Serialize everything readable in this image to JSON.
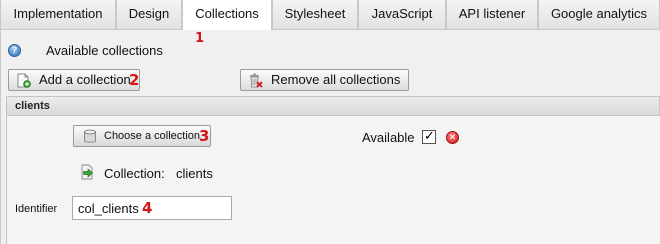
{
  "tabs": [
    {
      "label": "Implementation",
      "active": false
    },
    {
      "label": "Design",
      "active": false
    },
    {
      "label": "Collections",
      "active": true
    },
    {
      "label": "Stylesheet",
      "active": false
    },
    {
      "label": "JavaScript",
      "active": false
    },
    {
      "label": "API listener",
      "active": false
    },
    {
      "label": "Google analytics",
      "active": false
    }
  ],
  "annotations": {
    "n1": "1",
    "n2": "2",
    "n3": "3",
    "n4": "4"
  },
  "section": {
    "title": "Available collections",
    "help_icon": "help-icon"
  },
  "toolbar": {
    "add_label": "Add a collection",
    "add_icon": "add-document-icon",
    "remove_all_label": "Remove all collections",
    "remove_all_icon": "trash-delete-icon"
  },
  "collection": {
    "header": "clients",
    "choose_label": "Choose a collection",
    "choose_icon": "database-icon",
    "available_label": "Available",
    "available_checked": true,
    "delete_icon": "delete-icon",
    "collection_label": "Collection:",
    "collection_value": "clients",
    "collection_icon": "arrow-right-icon",
    "identifier_label": "Identifier",
    "identifier_value": "col_clients"
  },
  "colors": {
    "annotation": "#d01818",
    "active_tab": "#ffffff",
    "panel": "#f0f0f0"
  }
}
